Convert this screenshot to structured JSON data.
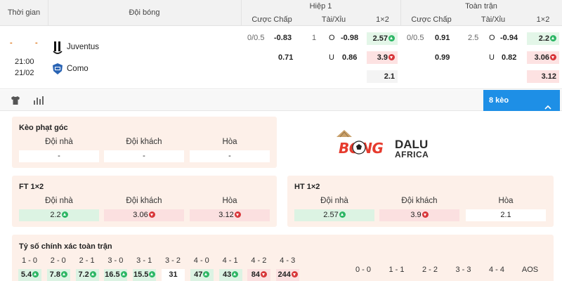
{
  "header": {
    "time_col": "Thời gian",
    "team_col": "Đội bóng",
    "half1": "Hiệp 1",
    "full": "Toàn trận",
    "handicap": "Cược Chấp",
    "overunder": "Tài/Xỉu",
    "onextwo": "1×2"
  },
  "match": {
    "dash1": "-",
    "dash2": "-",
    "time": "21:00",
    "date": "21/02",
    "home": "Juventus",
    "away": "Como",
    "h1": {
      "hdp_line": "0/0.5",
      "hdp_home": "-0.83",
      "hdp_away": "0.71",
      "ou_line": "1",
      "ou_o": "O",
      "ou_over": "-0.98",
      "ou_u": "U",
      "ou_under": "0.86",
      "x1": "2.57",
      "x2": "3.9",
      "xdraw": "2.1"
    },
    "ft": {
      "hdp_line": "0/0.5",
      "hdp_home": "0.91",
      "hdp_away": "0.99",
      "ou_line": "2.5",
      "ou_o": "O",
      "ou_over": "-0.94",
      "ou_u": "U",
      "ou_under": "0.82",
      "x1": "2.2",
      "x2": "3.06",
      "xdraw": "3.12"
    }
  },
  "toolbar": {
    "keo_label": "8 kèo"
  },
  "corner": {
    "title": "Kèo phạt góc",
    "home": "Đội nhà",
    "away": "Đội khách",
    "draw": "Hòa",
    "v_home": "-",
    "v_away": "-",
    "v_draw": "-"
  },
  "logo": {
    "bong": "BONG",
    "dalu": "DALU",
    "africa": "AFRICA"
  },
  "ft12": {
    "title": "FT 1×2",
    "home": "Đội nhà",
    "away": "Đội khách",
    "draw": "Hòa",
    "v_home": "2.2",
    "v_away": "3.06",
    "v_draw": "3.12"
  },
  "ht12": {
    "title": "HT 1×2",
    "home": "Đội nhà",
    "away": "Đội khách",
    "draw": "Hòa",
    "v_home": "2.57",
    "v_away": "3.9",
    "v_draw": "2.1"
  },
  "correct_score": {
    "title": "Tỷ số chính xác toàn trận",
    "labels_a": [
      "1 - 0",
      "2 - 0",
      "2 - 1",
      "3 - 0",
      "3 - 1",
      "3 - 2",
      "4 - 0",
      "4 - 1",
      "4 - 2",
      "4 - 3"
    ],
    "values_a": [
      "5.4",
      "7.8",
      "7.2",
      "16.5",
      "15.5",
      "31",
      "47",
      "43",
      "84",
      "244"
    ],
    "labels_b": [
      "0 - 0",
      "1 - 1",
      "2 - 2",
      "3 - 3",
      "4 - 4",
      "AOS"
    ]
  },
  "colors": {
    "accent": "#1e8fe6",
    "up": "#2db665",
    "down": "#d8363a",
    "card": "#fdf0e9"
  }
}
